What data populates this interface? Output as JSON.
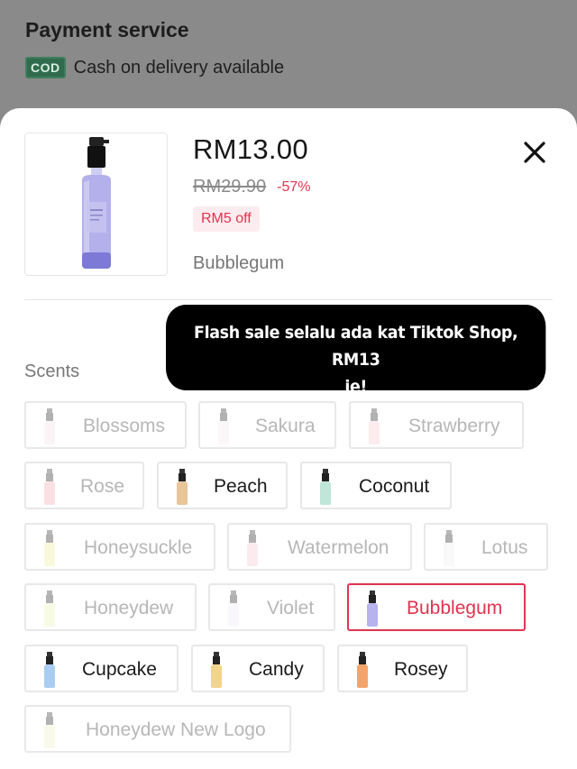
{
  "background": {
    "title": "Payment service",
    "cod_badge": "COD",
    "cod_text": "Cash on delivery available"
  },
  "product": {
    "price": "RM13.00",
    "original_price": "RM29.90",
    "discount": "-57%",
    "voucher": "RM5 off",
    "selected_variant": "Bubblegum"
  },
  "tooltip": {
    "line1": "Flash sale selalu ada kat Tiktok Shop, RM13",
    "line2": "je!"
  },
  "scents": {
    "label": "Scents",
    "options": [
      {
        "label": "Blossoms",
        "state": "disabled",
        "color": "#f3e1e6"
      },
      {
        "label": "Sakura",
        "state": "disabled",
        "color": "#f4e6ea"
      },
      {
        "label": "Strawberry",
        "state": "disabled",
        "color": "#f7c9cf"
      },
      {
        "label": "Rose",
        "state": "disabled",
        "color": "#f2a7b0"
      },
      {
        "label": "Peach",
        "state": "enabled",
        "color": "#e9c59a"
      },
      {
        "label": "Coconut",
        "state": "enabled",
        "color": "#bfe6d8"
      },
      {
        "label": "Honeysuckle",
        "state": "disabled",
        "color": "#f3ec9c"
      },
      {
        "label": "Watermelon",
        "state": "disabled",
        "color": "#f4c7cf"
      },
      {
        "label": "Lotus",
        "state": "disabled",
        "color": "#eeeeee"
      },
      {
        "label": "Honeydew",
        "state": "disabled",
        "color": "#eaf3b5"
      },
      {
        "label": "Violet",
        "state": "disabled",
        "color": "#efe9f4"
      },
      {
        "label": "Bubblegum",
        "state": "selected",
        "color": "#b7b3ee"
      },
      {
        "label": "Cupcake",
        "state": "enabled",
        "color": "#a9cdf2"
      },
      {
        "label": "Candy",
        "state": "enabled",
        "color": "#f1d58a"
      },
      {
        "label": "Rosey",
        "state": "enabled",
        "color": "#f3a46a"
      },
      {
        "label": "Honeydew New Logo",
        "state": "disabled",
        "color": "#eef3c4"
      }
    ]
  },
  "colors": {
    "accent": "#e0344f",
    "cod_green": "#2f6b4c",
    "tooltip_bg": "#000000"
  }
}
